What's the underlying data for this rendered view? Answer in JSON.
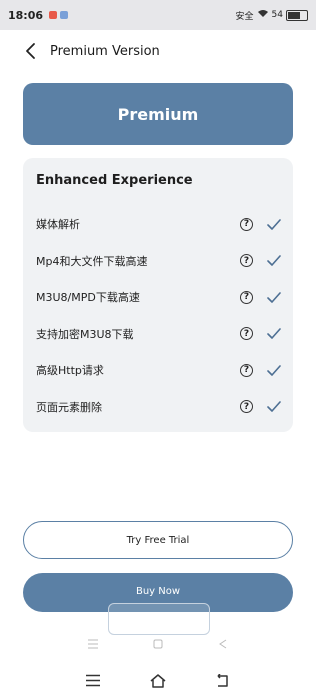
{
  "status_bar": {
    "time": "18:06",
    "right_text": "安全",
    "battery": "54"
  },
  "header": {
    "back_icon": "chevron-left-icon",
    "title": "Premium Version"
  },
  "premium_banner": {
    "label": "Premium"
  },
  "features_card": {
    "title": "Enhanced Experience",
    "items": [
      {
        "label": "媒体解析"
      },
      {
        "label": "Mp4和大文件下载高速"
      },
      {
        "label": "M3U8/MPD下载高速"
      },
      {
        "label": "支持加密M3U8下载"
      },
      {
        "label": "高级Http请求"
      },
      {
        "label": "页面元素删除"
      }
    ],
    "help_glyph": "?"
  },
  "buttons": {
    "trial_label": "Try Free Trial",
    "buy_label": "Buy Now"
  },
  "colors": {
    "accent": "#5b80a5",
    "card_bg": "#f0f2f4",
    "check": "#4d6f93"
  }
}
